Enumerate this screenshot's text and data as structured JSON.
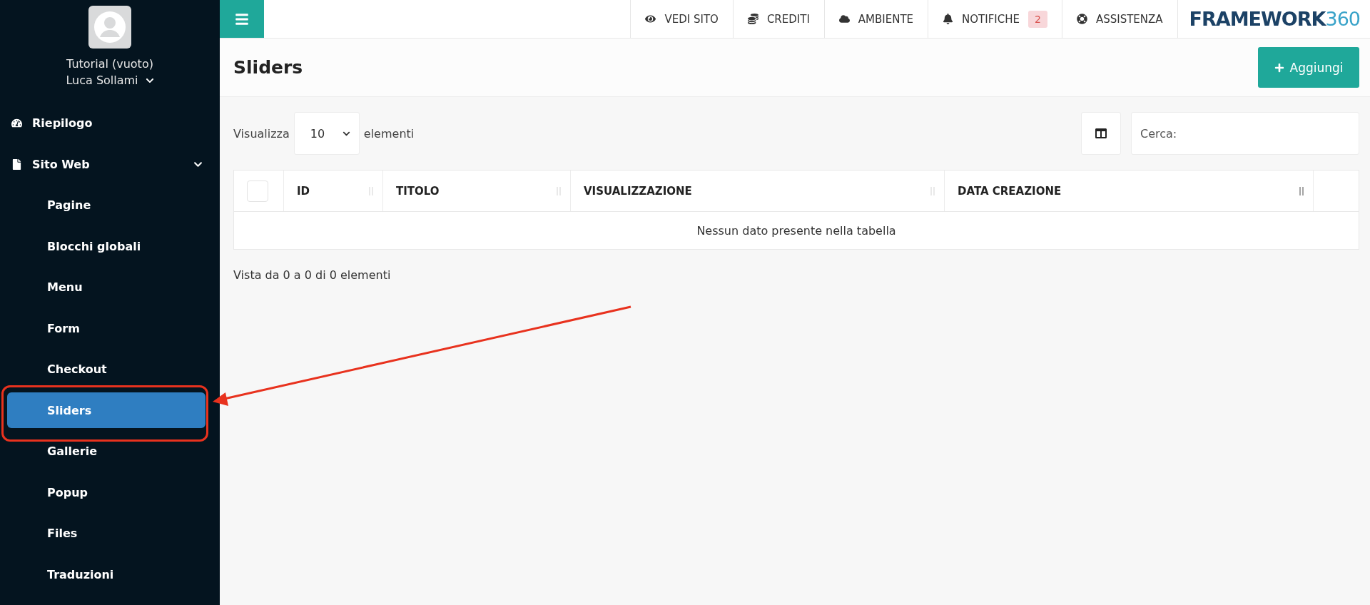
{
  "sidebar": {
    "project": "Tutorial (vuoto)",
    "user": "Luca Sollami",
    "items": [
      {
        "label": "Riepilogo",
        "kind": "dashboard",
        "selected": false
      },
      {
        "label": "Sito Web",
        "kind": "file",
        "selected": false,
        "expanded": true,
        "children": [
          {
            "label": "Pagine",
            "selected": false
          },
          {
            "label": "Blocchi globali",
            "selected": false
          },
          {
            "label": "Menu",
            "selected": false
          },
          {
            "label": "Form",
            "selected": false
          },
          {
            "label": "Checkout",
            "selected": false
          },
          {
            "label": "Sliders",
            "selected": true
          },
          {
            "label": "Gallerie",
            "selected": false
          },
          {
            "label": "Popup",
            "selected": false
          },
          {
            "label": "Files",
            "selected": false
          },
          {
            "label": "Traduzioni",
            "selected": false
          }
        ]
      }
    ]
  },
  "topbar": {
    "items": [
      {
        "label": "VEDI SITO",
        "kind": "eye"
      },
      {
        "label": "CREDITI",
        "kind": "coins"
      },
      {
        "label": "AMBIENTE",
        "kind": "cloud"
      },
      {
        "label": "NOTIFICHE",
        "kind": "bell",
        "badge": "2"
      },
      {
        "label": "ASSISTENZA",
        "kind": "lifebuoy"
      }
    ],
    "logo": {
      "word": "FRAMEWORK",
      "number": "360"
    }
  },
  "page": {
    "title": "Sliders",
    "add_button": "Aggiungi"
  },
  "table_controls": {
    "show_label": "Visualizza",
    "page_length": "10",
    "show_suffix": "elementi",
    "search": {
      "placeholder": "Cerca:"
    }
  },
  "table": {
    "select_all": {
      "checked": false
    },
    "columns": [
      "ID",
      "TITOLO",
      "VISUALIZZAZIONE",
      "DATA CREAZIONE"
    ],
    "empty_message": "Nessun dato presente nella tabella"
  },
  "info": "Vista da 0 a 0 di 0 elementi"
}
